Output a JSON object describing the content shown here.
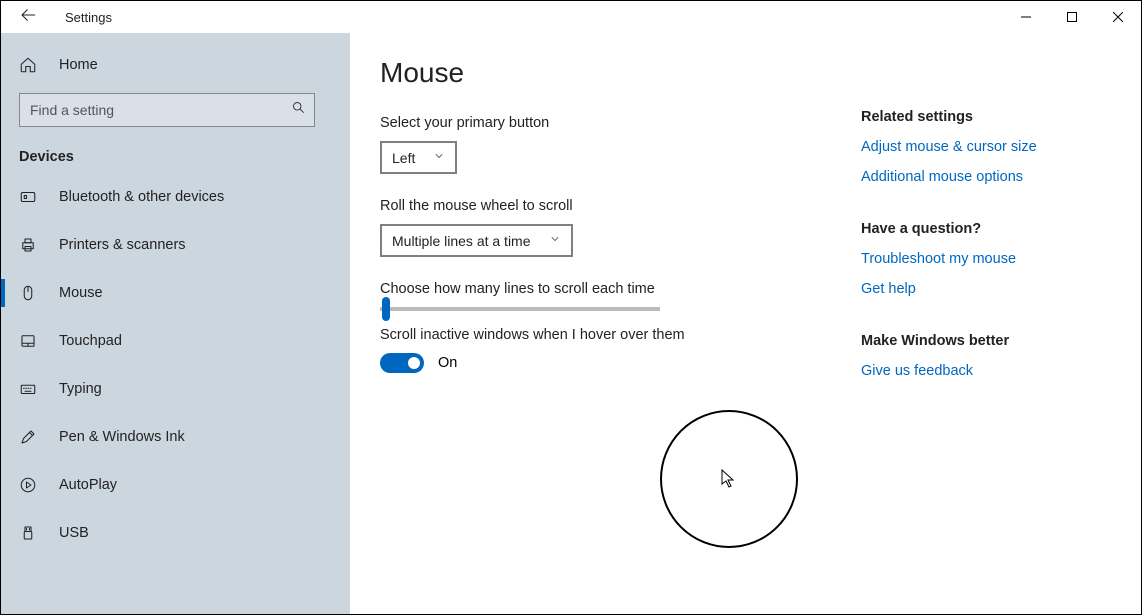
{
  "window": {
    "app_name": "Settings"
  },
  "sidebar": {
    "home_label": "Home",
    "search_placeholder": "Find a setting",
    "category": "Devices",
    "items": [
      {
        "label": "Bluetooth & other devices",
        "icon": "bluetooth-icon",
        "selected": false
      },
      {
        "label": "Printers & scanners",
        "icon": "printer-icon",
        "selected": false
      },
      {
        "label": "Mouse",
        "icon": "mouse-icon",
        "selected": true
      },
      {
        "label": "Touchpad",
        "icon": "touchpad-icon",
        "selected": false
      },
      {
        "label": "Typing",
        "icon": "keyboard-icon",
        "selected": false
      },
      {
        "label": "Pen & Windows Ink",
        "icon": "pen-icon",
        "selected": false
      },
      {
        "label": "AutoPlay",
        "icon": "autoplay-icon",
        "selected": false
      },
      {
        "label": "USB",
        "icon": "usb-icon",
        "selected": false
      }
    ]
  },
  "page": {
    "title": "Mouse",
    "primary_button": {
      "label": "Select your primary button",
      "value": "Left"
    },
    "scroll_mode": {
      "label": "Roll the mouse wheel to scroll",
      "value": "Multiple lines at a time"
    },
    "scroll_lines": {
      "label": "Choose how many lines to scroll each time"
    },
    "inactive_scroll": {
      "label": "Scroll inactive windows when I hover over them",
      "value": "On"
    }
  },
  "aside": {
    "related": {
      "heading": "Related settings",
      "links": [
        "Adjust mouse & cursor size",
        "Additional mouse options"
      ]
    },
    "question": {
      "heading": "Have a question?",
      "links": [
        "Troubleshoot my mouse",
        "Get help"
      ]
    },
    "feedback": {
      "heading": "Make Windows better",
      "links": [
        "Give us feedback"
      ]
    }
  }
}
